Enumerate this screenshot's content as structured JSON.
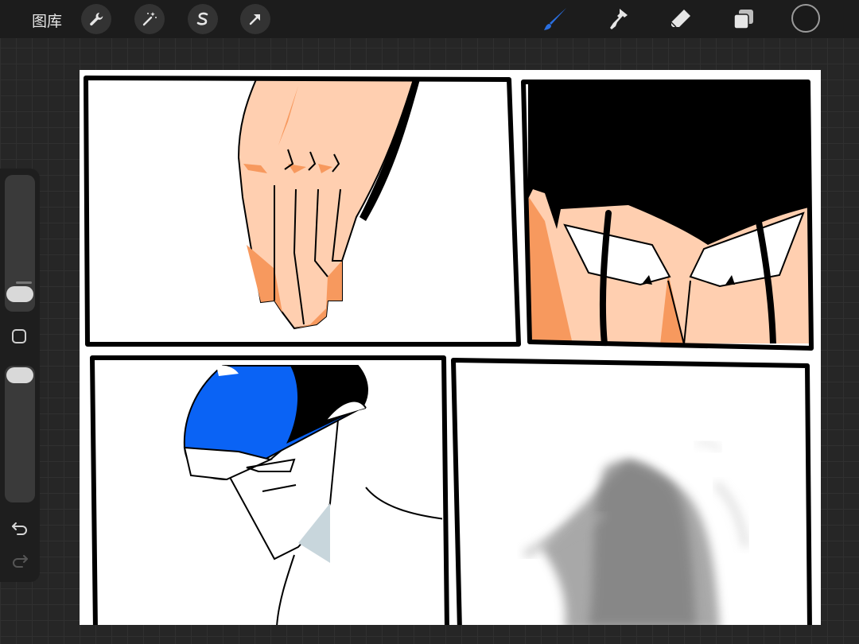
{
  "toolbar": {
    "gallery_label": "图库",
    "left_tools": [
      "wrench-icon",
      "magic-wand-icon",
      "selection-s-icon",
      "transform-arrow-icon"
    ],
    "right_tools": [
      "brush-icon",
      "smudge-icon",
      "eraser-icon",
      "layers-icon"
    ],
    "active_tool": "brush-icon",
    "active_color": "#2a6fe0",
    "current_color": "#1a1a1a"
  },
  "sidebar": {
    "brush_size_level": 0.07,
    "opacity_level": 1.0,
    "buttons": [
      "modify-button",
      "undo-button",
      "redo-button"
    ]
  },
  "canvas": {
    "background": "#ffffff",
    "panels": [
      "hand-panel",
      "eyes-panel",
      "masked-face-panel",
      "sketch-panel"
    ],
    "colors": {
      "skin": "#ffcfb0",
      "skin_shadow": "#f7995e",
      "hair": "#000000",
      "mask_blue": "#0a63f5",
      "face_shadow": "#c8d6dc"
    }
  }
}
